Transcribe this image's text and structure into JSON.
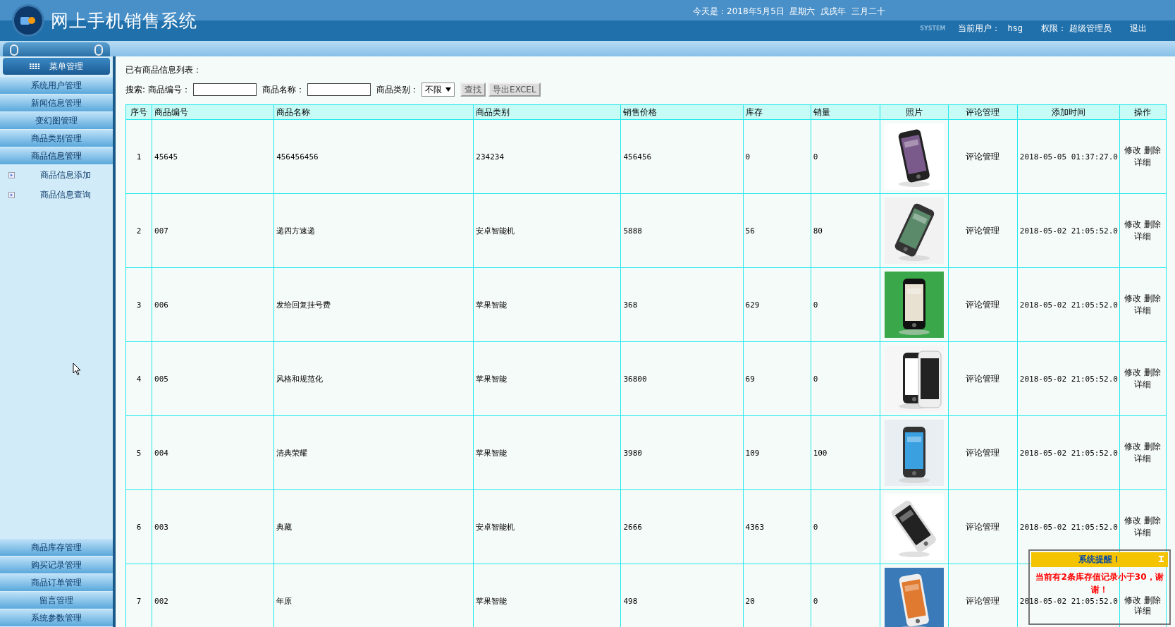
{
  "header": {
    "title": "网上手机销售系统",
    "date": "今天是：2018年5月5日  星期六  戊戌年  三月二十",
    "badge": "SYSTEM",
    "user_label": "当前用户：",
    "user": "hsg",
    "role_label": "权限：",
    "role": "超级管理员",
    "logout": "退出"
  },
  "sidebar": {
    "header": "菜单管理",
    "top_items": [
      {
        "label": "系统用户管理"
      },
      {
        "label": "新闻信息管理"
      },
      {
        "label": "变幻图管理"
      },
      {
        "label": "商品类别管理"
      },
      {
        "label": "商品信息管理",
        "expanded": true,
        "children": [
          {
            "label": "商品信息添加"
          },
          {
            "label": "商品信息查询"
          }
        ]
      }
    ],
    "bottom_items": [
      {
        "label": "商品库存管理"
      },
      {
        "label": "购买记录管理"
      },
      {
        "label": "商品订单管理"
      },
      {
        "label": "留言管理"
      },
      {
        "label": "系统参数管理"
      }
    ]
  },
  "content": {
    "heading": "已有商品信息列表：",
    "search": {
      "label": "搜索:",
      "fields": [
        {
          "label": "商品编号："
        },
        {
          "label": "商品名称："
        }
      ],
      "category_label": "商品类别：",
      "category_value": "不限",
      "search_button": "查找",
      "export_button": "导出EXCEL"
    },
    "table": {
      "columns": [
        "序号",
        "商品编号",
        "商品名称",
        "商品类别",
        "销售价格",
        "库存",
        "销量",
        "照片",
        "评论管理",
        "添加时间",
        "操作"
      ],
      "rows": [
        {
          "index": "1",
          "code": "45645",
          "name": "456456456",
          "category": "234234",
          "price": "456456",
          "stock": "0",
          "sales": "0",
          "review": "评论管理",
          "added": "2018-05-05 01:37:27.0",
          "actions": [
            "修改",
            "删除",
            "详细"
          ]
        },
        {
          "index": "2",
          "code": "007",
          "name": "递四方速递",
          "category": "安卓智能机",
          "price": "5888",
          "stock": "56",
          "sales": "80",
          "review": "评论管理",
          "added": "2018-05-02 21:05:52.0",
          "actions": [
            "修改",
            "删除",
            "详细"
          ]
        },
        {
          "index": "3",
          "code": "006",
          "name": "发给回复挂号费",
          "category": "苹果智能",
          "price": "368",
          "stock": "629",
          "sales": "0",
          "review": "评论管理",
          "added": "2018-05-02 21:05:52.0",
          "actions": [
            "修改",
            "删除",
            "详细"
          ]
        },
        {
          "index": "4",
          "code": "005",
          "name": "风格和规范化",
          "category": "苹果智能",
          "price": "36800",
          "stock": "69",
          "sales": "0",
          "review": "评论管理",
          "added": "2018-05-02 21:05:52.0",
          "actions": [
            "修改",
            "删除",
            "详细"
          ]
        },
        {
          "index": "5",
          "code": "004",
          "name": "清典荣耀",
          "category": "苹果智能",
          "price": "3980",
          "stock": "109",
          "sales": "100",
          "review": "评论管理",
          "added": "2018-05-02 21:05:52.0",
          "actions": [
            "修改",
            "删除",
            "详细"
          ]
        },
        {
          "index": "6",
          "code": "003",
          "name": "典藏",
          "category": "安卓智能机",
          "price": "2666",
          "stock": "4363",
          "sales": "0",
          "review": "评论管理",
          "added": "2018-05-02 21:05:52.0",
          "actions": [
            "修改",
            "删除",
            "详细"
          ]
        },
        {
          "index": "7",
          "code": "002",
          "name": "年原",
          "category": "苹果智能",
          "price": "498",
          "stock": "20",
          "sales": "0",
          "review": "评论管理",
          "added": "2018-05-02 21:05:52.0",
          "actions": [
            "修改",
            "删除",
            "详细"
          ]
        }
      ]
    }
  },
  "popup": {
    "title": "系统提醒！",
    "message": "当前有2条库存值记录小于30，谢谢！"
  }
}
